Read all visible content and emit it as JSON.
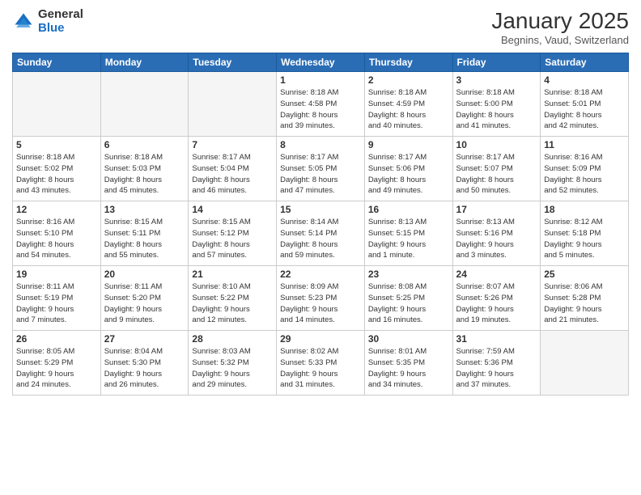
{
  "header": {
    "logo_general": "General",
    "logo_blue": "Blue",
    "month_title": "January 2025",
    "location": "Begnins, Vaud, Switzerland"
  },
  "days_of_week": [
    "Sunday",
    "Monday",
    "Tuesday",
    "Wednesday",
    "Thursday",
    "Friday",
    "Saturday"
  ],
  "weeks": [
    [
      {
        "day": "",
        "info": ""
      },
      {
        "day": "",
        "info": ""
      },
      {
        "day": "",
        "info": ""
      },
      {
        "day": "1",
        "info": "Sunrise: 8:18 AM\nSunset: 4:58 PM\nDaylight: 8 hours\nand 39 minutes."
      },
      {
        "day": "2",
        "info": "Sunrise: 8:18 AM\nSunset: 4:59 PM\nDaylight: 8 hours\nand 40 minutes."
      },
      {
        "day": "3",
        "info": "Sunrise: 8:18 AM\nSunset: 5:00 PM\nDaylight: 8 hours\nand 41 minutes."
      },
      {
        "day": "4",
        "info": "Sunrise: 8:18 AM\nSunset: 5:01 PM\nDaylight: 8 hours\nand 42 minutes."
      }
    ],
    [
      {
        "day": "5",
        "info": "Sunrise: 8:18 AM\nSunset: 5:02 PM\nDaylight: 8 hours\nand 43 minutes."
      },
      {
        "day": "6",
        "info": "Sunrise: 8:18 AM\nSunset: 5:03 PM\nDaylight: 8 hours\nand 45 minutes."
      },
      {
        "day": "7",
        "info": "Sunrise: 8:17 AM\nSunset: 5:04 PM\nDaylight: 8 hours\nand 46 minutes."
      },
      {
        "day": "8",
        "info": "Sunrise: 8:17 AM\nSunset: 5:05 PM\nDaylight: 8 hours\nand 47 minutes."
      },
      {
        "day": "9",
        "info": "Sunrise: 8:17 AM\nSunset: 5:06 PM\nDaylight: 8 hours\nand 49 minutes."
      },
      {
        "day": "10",
        "info": "Sunrise: 8:17 AM\nSunset: 5:07 PM\nDaylight: 8 hours\nand 50 minutes."
      },
      {
        "day": "11",
        "info": "Sunrise: 8:16 AM\nSunset: 5:09 PM\nDaylight: 8 hours\nand 52 minutes."
      }
    ],
    [
      {
        "day": "12",
        "info": "Sunrise: 8:16 AM\nSunset: 5:10 PM\nDaylight: 8 hours\nand 54 minutes."
      },
      {
        "day": "13",
        "info": "Sunrise: 8:15 AM\nSunset: 5:11 PM\nDaylight: 8 hours\nand 55 minutes."
      },
      {
        "day": "14",
        "info": "Sunrise: 8:15 AM\nSunset: 5:12 PM\nDaylight: 8 hours\nand 57 minutes."
      },
      {
        "day": "15",
        "info": "Sunrise: 8:14 AM\nSunset: 5:14 PM\nDaylight: 8 hours\nand 59 minutes."
      },
      {
        "day": "16",
        "info": "Sunrise: 8:13 AM\nSunset: 5:15 PM\nDaylight: 9 hours\nand 1 minute."
      },
      {
        "day": "17",
        "info": "Sunrise: 8:13 AM\nSunset: 5:16 PM\nDaylight: 9 hours\nand 3 minutes."
      },
      {
        "day": "18",
        "info": "Sunrise: 8:12 AM\nSunset: 5:18 PM\nDaylight: 9 hours\nand 5 minutes."
      }
    ],
    [
      {
        "day": "19",
        "info": "Sunrise: 8:11 AM\nSunset: 5:19 PM\nDaylight: 9 hours\nand 7 minutes."
      },
      {
        "day": "20",
        "info": "Sunrise: 8:11 AM\nSunset: 5:20 PM\nDaylight: 9 hours\nand 9 minutes."
      },
      {
        "day": "21",
        "info": "Sunrise: 8:10 AM\nSunset: 5:22 PM\nDaylight: 9 hours\nand 12 minutes."
      },
      {
        "day": "22",
        "info": "Sunrise: 8:09 AM\nSunset: 5:23 PM\nDaylight: 9 hours\nand 14 minutes."
      },
      {
        "day": "23",
        "info": "Sunrise: 8:08 AM\nSunset: 5:25 PM\nDaylight: 9 hours\nand 16 minutes."
      },
      {
        "day": "24",
        "info": "Sunrise: 8:07 AM\nSunset: 5:26 PM\nDaylight: 9 hours\nand 19 minutes."
      },
      {
        "day": "25",
        "info": "Sunrise: 8:06 AM\nSunset: 5:28 PM\nDaylight: 9 hours\nand 21 minutes."
      }
    ],
    [
      {
        "day": "26",
        "info": "Sunrise: 8:05 AM\nSunset: 5:29 PM\nDaylight: 9 hours\nand 24 minutes."
      },
      {
        "day": "27",
        "info": "Sunrise: 8:04 AM\nSunset: 5:30 PM\nDaylight: 9 hours\nand 26 minutes."
      },
      {
        "day": "28",
        "info": "Sunrise: 8:03 AM\nSunset: 5:32 PM\nDaylight: 9 hours\nand 29 minutes."
      },
      {
        "day": "29",
        "info": "Sunrise: 8:02 AM\nSunset: 5:33 PM\nDaylight: 9 hours\nand 31 minutes."
      },
      {
        "day": "30",
        "info": "Sunrise: 8:01 AM\nSunset: 5:35 PM\nDaylight: 9 hours\nand 34 minutes."
      },
      {
        "day": "31",
        "info": "Sunrise: 7:59 AM\nSunset: 5:36 PM\nDaylight: 9 hours\nand 37 minutes."
      },
      {
        "day": "",
        "info": ""
      }
    ]
  ]
}
